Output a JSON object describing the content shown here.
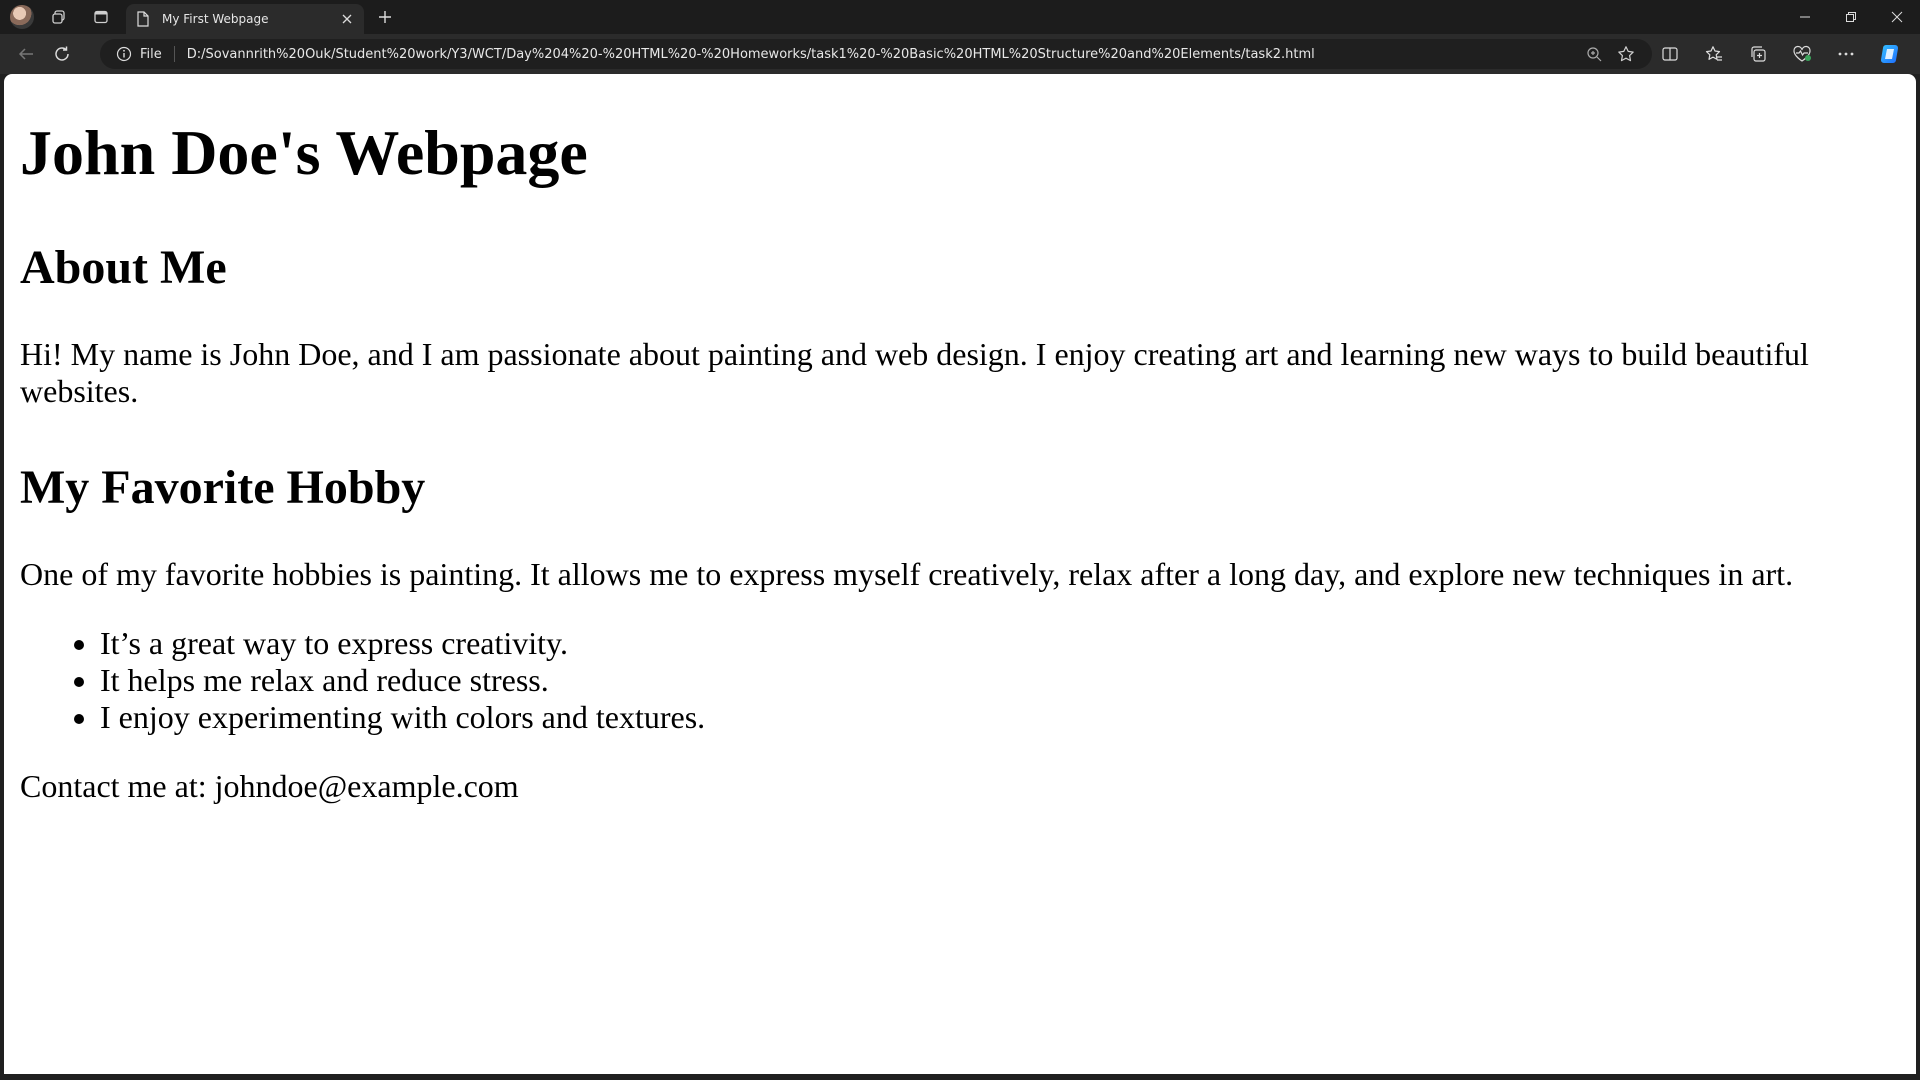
{
  "browser": {
    "tab": {
      "title": "My First Webpage"
    },
    "address_bar": {
      "site_info_label": "File",
      "url": "D:/Sovannrith%20Ouk/Student%20work/Y3/WCT/Day%204%20-%20HTML%20-%20Homeworks/task1%20-%20Basic%20HTML%20Structure%20and%20Elements/task2.html"
    },
    "icons": {
      "profile": "profile-avatar-icon",
      "workspaces": "workspaces-icon",
      "vertical_tabs": "vertical-tabs-icon",
      "new_tab": "plus-icon",
      "minimize": "minimize-icon",
      "restore": "restore-icon",
      "close": "close-icon",
      "back": "back-arrow-icon",
      "refresh": "refresh-icon",
      "info": "info-icon",
      "zoom": "zoom-icon",
      "favorite": "star-icon",
      "split_screen": "split-screen-icon",
      "favorites": "favorites-icon",
      "collections": "collections-icon",
      "browser_essentials": "heart-pulse-icon",
      "more": "more-icon",
      "copilot": "copilot-icon"
    },
    "accent_color": "#1e90ff"
  },
  "page": {
    "heading": "John Doe's Webpage",
    "about": {
      "heading": "About Me",
      "text": "Hi! My name is John Doe, and I am passionate about painting and web design. I enjoy creating art and learning new ways to build beautiful websites."
    },
    "hobby": {
      "heading": "My Favorite Hobby",
      "text": "One of my favorite hobbies is painting. It allows me to express myself creatively, relax after a long day, and explore new techniques in art.",
      "reasons": [
        "It’s a great way to express creativity.",
        "It helps me relax and reduce stress.",
        "I enjoy experimenting with colors and textures."
      ]
    },
    "contact": "Contact me at: johndoe@example.com"
  }
}
